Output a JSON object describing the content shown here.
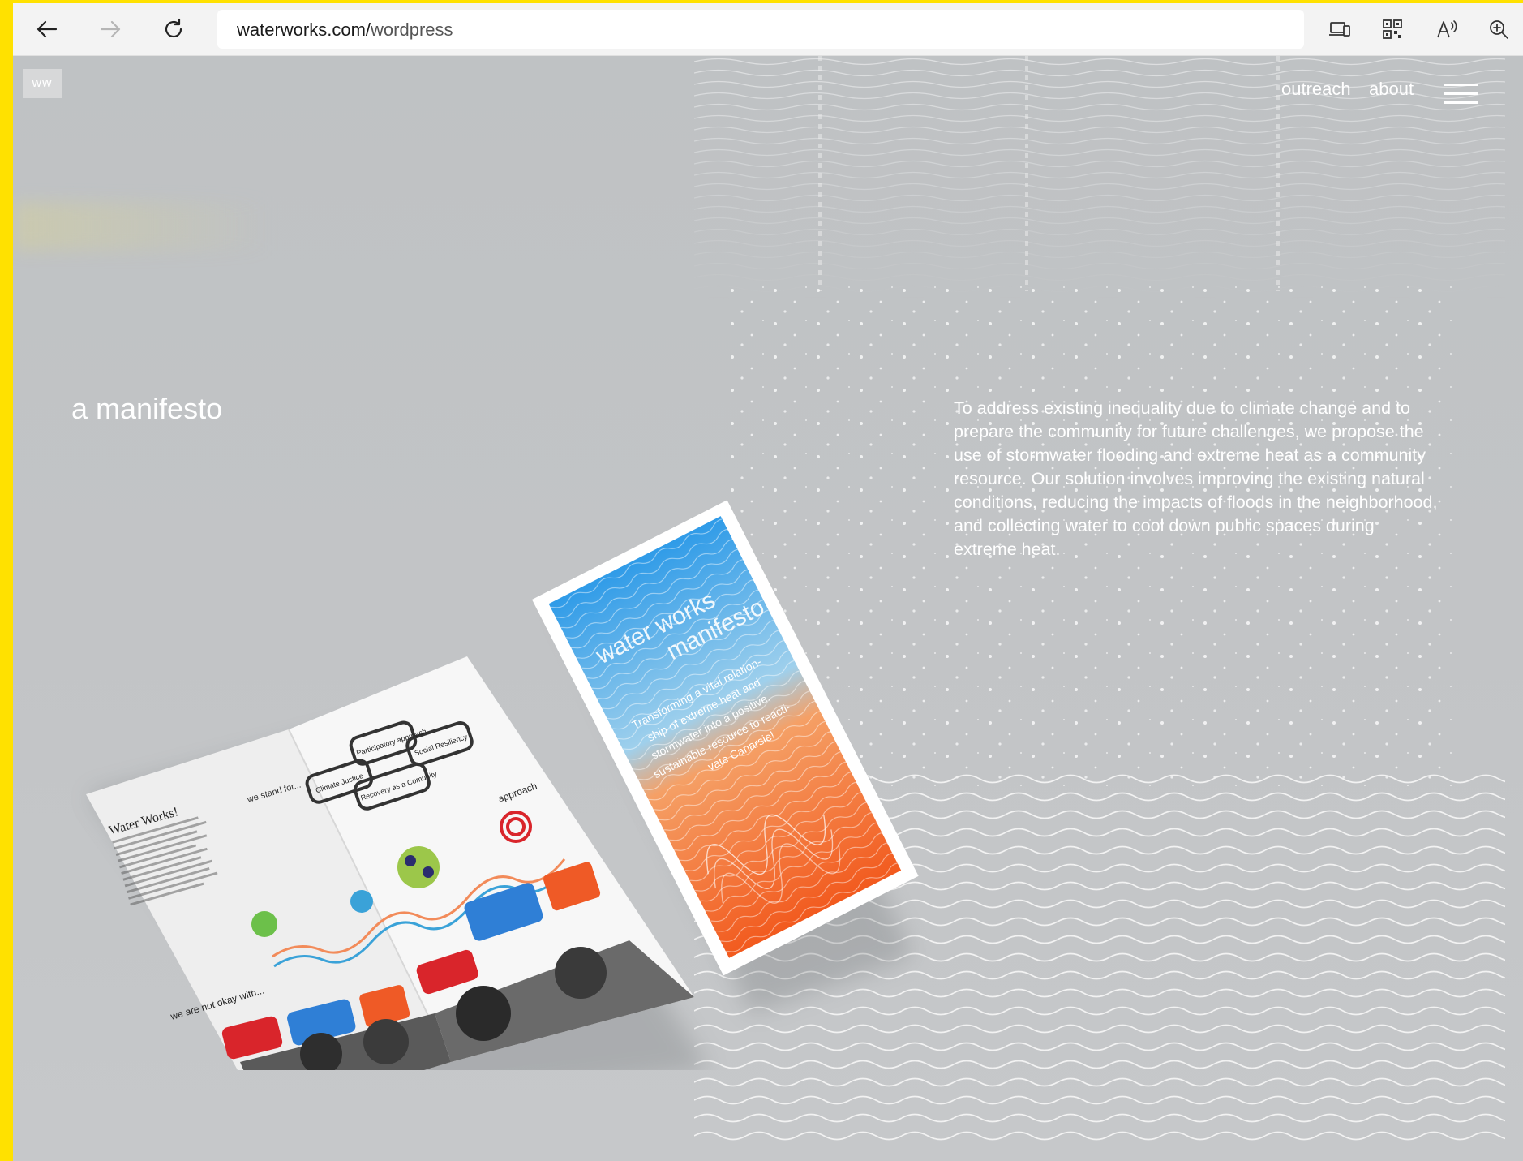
{
  "browser": {
    "url_domain": "waterworks.com/",
    "url_path": "wordpress"
  },
  "site": {
    "logo": "ww",
    "nav": [
      {
        "label": "outreach"
      },
      {
        "label": "about"
      }
    ],
    "title": "a manifesto",
    "manifesto_text": "To address existing inequality due to climate change and to prepare the community for future challenges, we propose the use of stormwater flooding and extreme heat as a community resource. Our solution involves improving the existing natural conditions, reducing the impacts of floods in the neighborhood, and collecting water to cool down public spaces during extreme heat."
  },
  "brochure": {
    "cover_title_1": "water works",
    "cover_title_2": "manifesto",
    "cover_quote_1": "Transforming a vital relation-",
    "cover_quote_2": "ship of extreme heat and",
    "cover_quote_3": "stormwater into a positive,",
    "cover_quote_4": "sustainable resource to reacti-",
    "cover_quote_5": "vate Canarsie!",
    "inside_heading": "Water Works!",
    "we_stand_for": "we stand for...",
    "approach": "approach",
    "we_are_not_okay": "we are not okay with...",
    "bubble_1": "Climate Justice",
    "bubble_2": "Participatory approach",
    "bubble_3": "Social Resiliency",
    "bubble_4": "Recovery as a Comunity"
  },
  "colors": {
    "page_bg": "#c3c5c7",
    "accent_yellow": "#ffe100",
    "cover_blue": "#2f9be8",
    "cover_orange": "#f25a1e"
  }
}
